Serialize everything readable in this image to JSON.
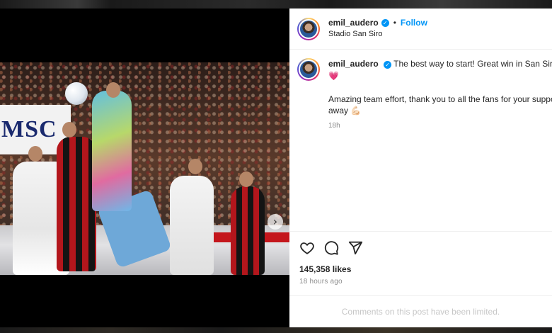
{
  "post": {
    "username": "emil_audero",
    "verified_mark": "✓",
    "separator": "•",
    "follow_label": "Follow",
    "location": "Stadio San Siro",
    "caption_line1": "The best way to start! Great win in San Siro 🩶",
    "caption_line1b": "💗",
    "caption_p2_line1": "Amazing team effort, thank you to all the fans for your support",
    "caption_p2_line2": "away 💪🏻",
    "caption_time": "18h",
    "likes": "145,358 likes",
    "time_ago": "18 hours ago",
    "comments_limited": "Comments on this post have been limited."
  },
  "media": {
    "banner_text": "MSC",
    "next_glyph": "›"
  },
  "icons": [
    "heart-icon",
    "comment-icon",
    "share-icon",
    "chevron-right-icon",
    "verified-icon"
  ],
  "colors": {
    "accent": "#0095f6",
    "text": "#262626",
    "muted": "#8e8e8e",
    "divider": "#efefef"
  }
}
